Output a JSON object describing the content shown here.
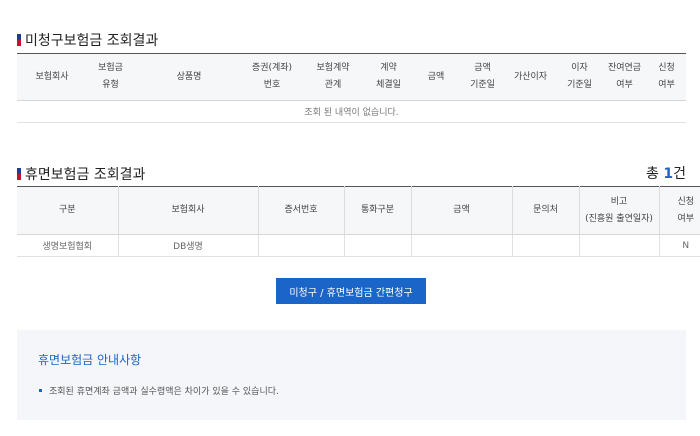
{
  "unclaimed": {
    "title": "미청구보험금 조회결과",
    "headers": [
      [
        "보험회사"
      ],
      [
        "보험금",
        "유형"
      ],
      [
        "상품명"
      ],
      [
        "증권(계좌)",
        "번호"
      ],
      [
        "보험계약",
        "관계"
      ],
      [
        "계약",
        "체결일"
      ],
      [
        "금액"
      ],
      [
        "금액",
        "기준일"
      ],
      [
        "가산이자"
      ],
      [
        "이자",
        "기준일"
      ],
      [
        "잔여연금",
        "여부"
      ],
      [
        "신청",
        "여부"
      ]
    ],
    "empty_message": "조회 된 내역이 없습니다."
  },
  "dormant": {
    "title": "휴면보험금 조회결과",
    "total_label": "총",
    "total_count": "1",
    "total_unit": "건",
    "headers": [
      [
        "구분"
      ],
      [
        "보험회사"
      ],
      [
        "증서번호"
      ],
      [
        "통화구분"
      ],
      [
        "금액"
      ],
      [
        "문의처"
      ],
      [
        "비고",
        "(진흥원 출연일자)"
      ],
      [
        "신청",
        "여부"
      ]
    ],
    "rows": [
      [
        "생명보험협회",
        "DB생명",
        "",
        "",
        "",
        "",
        "",
        "N"
      ]
    ]
  },
  "button": {
    "claim_label": "미청구 / 휴면보험금 간편청구"
  },
  "notice": {
    "title": "휴면보험금 안내사항",
    "items": [
      "조회된 휴면계좌 금액과 실수령액은 차이가 있을 수 있습니다."
    ]
  },
  "colors": {
    "accent": "#1b64c8",
    "mark_red": "#c41230",
    "mark_blue": "#1c3f94"
  }
}
